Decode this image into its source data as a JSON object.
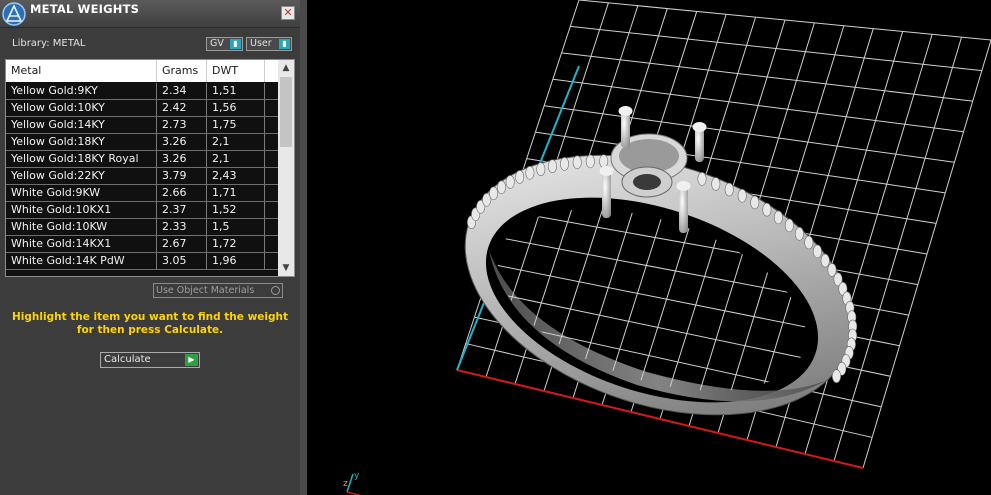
{
  "panel": {
    "title": "METAL WEIGHTS",
    "close_label": "✕",
    "library_label": "Library: METAL",
    "buttons": {
      "gv": "GV",
      "user": "User"
    },
    "columns": [
      "Metal",
      "Grams",
      "DWT"
    ],
    "rows": [
      {
        "metal": "Yellow Gold:9KY",
        "grams": "2.34",
        "dwt": "1,51"
      },
      {
        "metal": "Yellow Gold:10KY",
        "grams": "2.42",
        "dwt": "1,56"
      },
      {
        "metal": "Yellow Gold:14KY",
        "grams": "2.73",
        "dwt": "1,75"
      },
      {
        "metal": "Yellow Gold:18KY",
        "grams": "3.26",
        "dwt": "2,1"
      },
      {
        "metal": "Yellow Gold:18KY Royal",
        "grams": "3.26",
        "dwt": "2,1"
      },
      {
        "metal": "Yellow Gold:22KY",
        "grams": "3.79",
        "dwt": "2,43"
      },
      {
        "metal": "White Gold:9KW",
        "grams": "2.66",
        "dwt": "1,71"
      },
      {
        "metal": "White Gold:10KX1",
        "grams": "2.37",
        "dwt": "1,52"
      },
      {
        "metal": "White Gold:10KW",
        "grams": "2.33",
        "dwt": "1,5"
      },
      {
        "metal": "White Gold:14KX1",
        "grams": "2.67",
        "dwt": "1,72"
      },
      {
        "metal": "White Gold:14K PdW",
        "grams": "3.05",
        "dwt": "1,96"
      }
    ],
    "use_object_materials": "Use Object Materials",
    "instruction_line1": "Highlight the item you want to find the weight",
    "instruction_line2": "for then press Calculate.",
    "calculate_label": "Calculate"
  },
  "viewport": {
    "axis_label": "y",
    "colors": {
      "grid": "#d0d0d0",
      "x_axis": "#d11a1a",
      "y_axis": "#1fb5c9",
      "instruction": "#ffd400"
    }
  },
  "icons": [
    "app-logo-icon",
    "close-icon",
    "toggle-icon",
    "radio-icon",
    "play-arrow-icon",
    "scroll-up-icon",
    "scroll-down-icon",
    "axis-gizmo-icon"
  ]
}
